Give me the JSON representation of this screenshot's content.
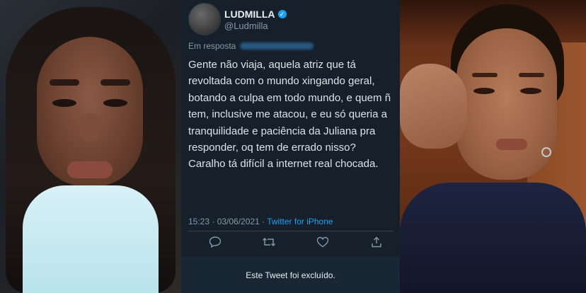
{
  "tweet": {
    "display_name": "LUDMILLA",
    "handle": "@Ludmilla",
    "reply_prefix": "Em resposta",
    "text": "Gente não viaja, aquela atriz que tá revoltada com o mundo xingando geral, botando a culpa em todo mundo, e quem ñ tem, inclusive me atacou, e eu só queria a tranquilidade e paciência da Juliana pra responder, oq tem de errado nisso? Caralho tá difícil a internet real chocada.",
    "time_date": "15:23 · 03/06/2021 · ",
    "source": "Twitter for iPhone",
    "deleted_notice": "Este Tweet foi excluído.",
    "colors": {
      "background": "#15202b",
      "accent": "#1da1f2",
      "muted": "#8899a6"
    },
    "icons": [
      "reply-icon",
      "retweet-icon",
      "like-icon",
      "share-icon"
    ]
  }
}
